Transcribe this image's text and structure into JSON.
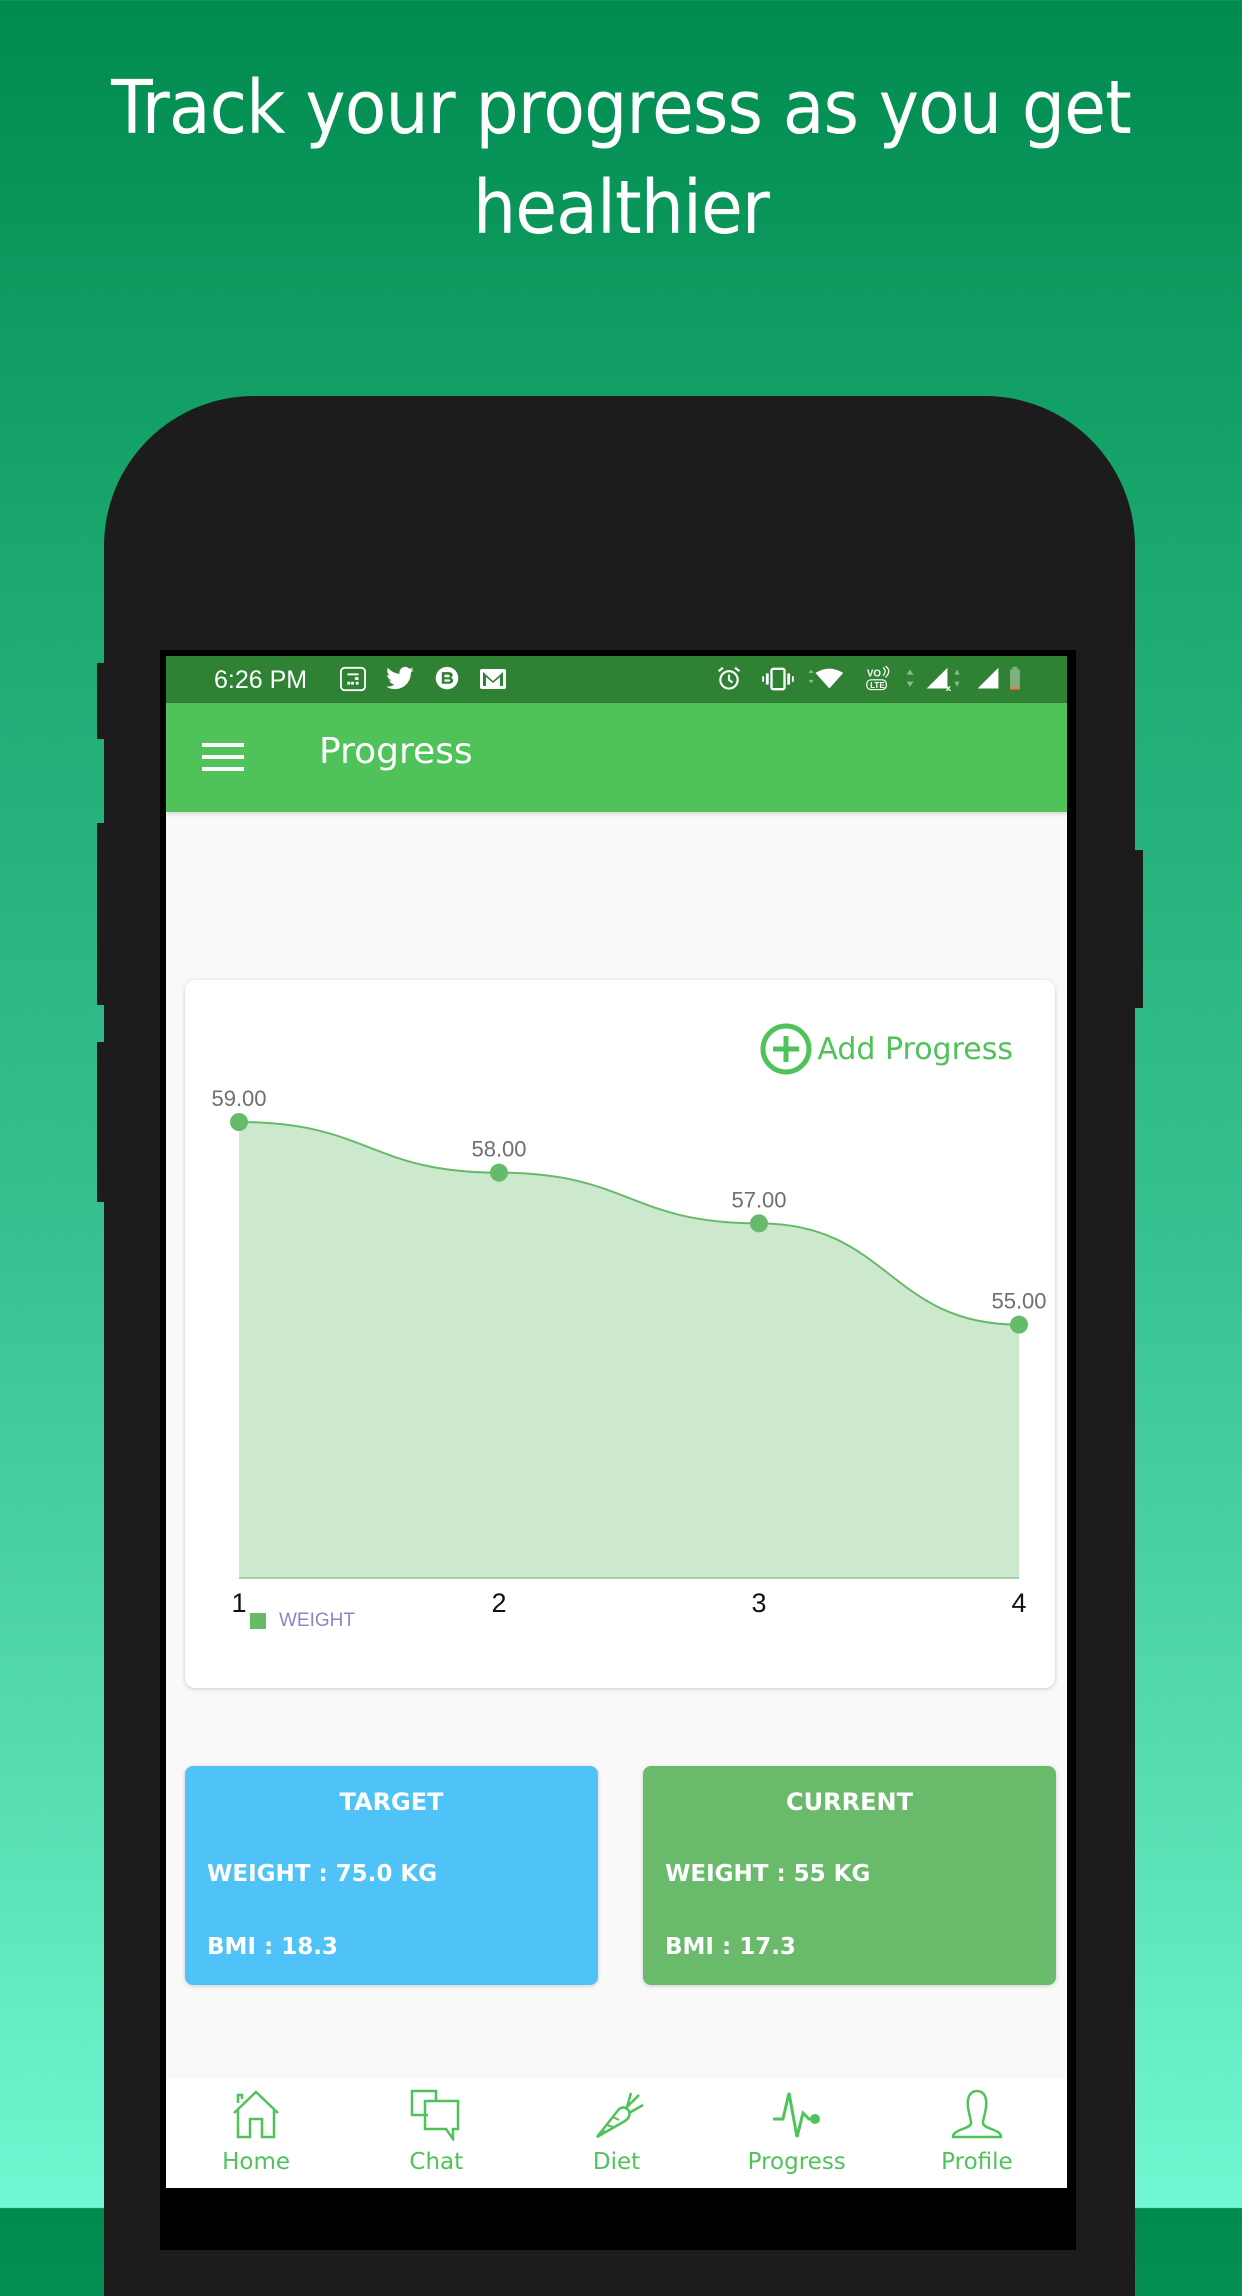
{
  "headline": {
    "line1": "Track your progress as you get",
    "line2": "healthier"
  },
  "status_bar": {
    "time": "6:26 PM",
    "left_icons": [
      "calendar-icon",
      "twitter-icon",
      "b-circle-icon",
      "gmail-icon"
    ],
    "right_icons": [
      "alarm-icon",
      "vibrate-icon",
      "wifi-icon",
      "volte-icon",
      "signal-x-icon",
      "signal-icon",
      "battery-low-icon"
    ]
  },
  "app_bar": {
    "title": "Progress",
    "menu_icon": "hamburger-menu-icon"
  },
  "chart_card": {
    "add_button_label": "Add Progress",
    "add_button_icon": "plus-circle-icon"
  },
  "chart_data": {
    "type": "area",
    "title": "",
    "xlabel": "",
    "ylabel": "",
    "x": [
      1,
      2,
      3,
      4
    ],
    "categories": [
      "1",
      "2",
      "3",
      "4"
    ],
    "series": [
      {
        "name": "WEIGHT",
        "values": [
          59.0,
          58.0,
          57.0,
          55.0
        ],
        "labels": [
          "59.00",
          "58.00",
          "57.00",
          "55.00"
        ],
        "color": "#66bb6a"
      }
    ],
    "ylim": [
      50,
      60
    ],
    "grid": false,
    "smooth": true,
    "legend": "bottom-left"
  },
  "stats": {
    "target": {
      "title": "TARGET",
      "weight": "WEIGHT : 75.0 KG",
      "bmi": "BMI : 18.3",
      "color": "#4fc3f7"
    },
    "current": {
      "title": "CURRENT",
      "weight": "WEIGHT : 55 KG",
      "bmi": "BMI : 17.3",
      "color": "#6aba6c"
    }
  },
  "bottom_nav": {
    "items": [
      {
        "label": "Home",
        "icon": "home-icon"
      },
      {
        "label": "Chat",
        "icon": "chat-icon"
      },
      {
        "label": "Diet",
        "icon": "carrot-icon"
      },
      {
        "label": "Progress",
        "icon": "pulse-icon"
      },
      {
        "label": "Profile",
        "icon": "profile-icon"
      }
    ],
    "active": "Progress"
  },
  "colors": {
    "primary": "#4fc35a",
    "status_bar": "#2f8133",
    "accent_line": "#66bb6a",
    "area_fill": "#cde9cd"
  }
}
